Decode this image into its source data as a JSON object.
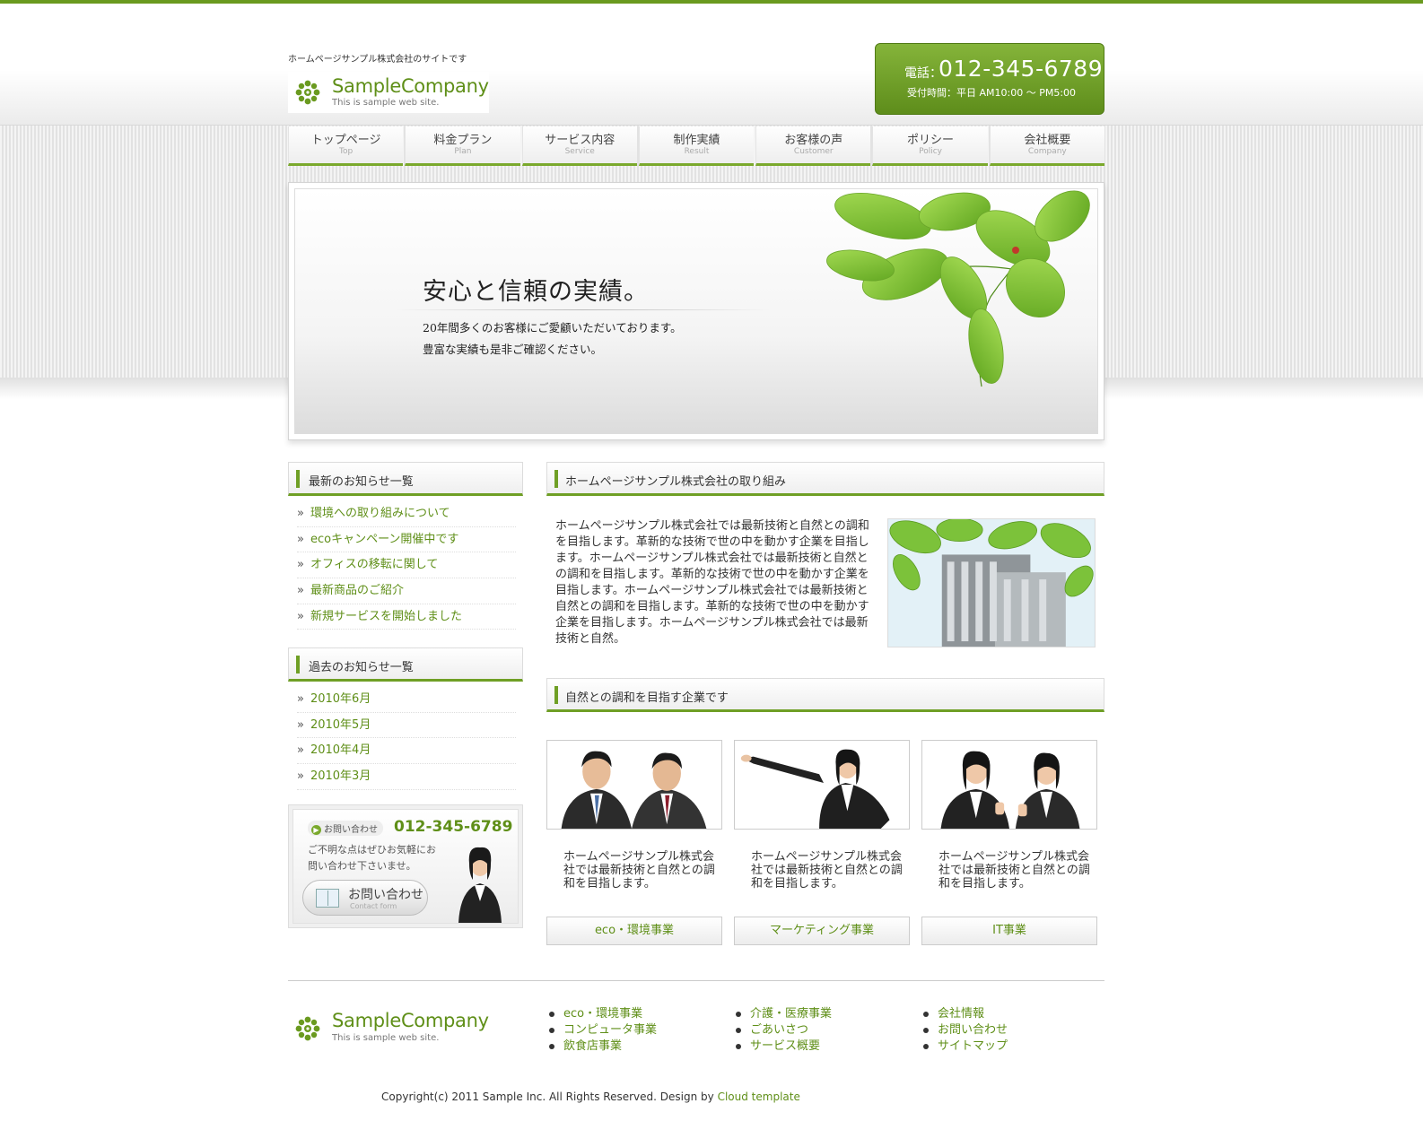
{
  "header": {
    "tagline": "ホームページサンプル株式会社のサイトです",
    "logo_name": "SampleCompany",
    "logo_sub": "This is sample web site.",
    "tel_label": "電話：",
    "tel_number": "012-345-6789",
    "tel_hours": "受付時間：平日 AM10:00 〜 PM5:00"
  },
  "nav": [
    {
      "jp": "トップページ",
      "en": "Top"
    },
    {
      "jp": "料金プラン",
      "en": "Plan"
    },
    {
      "jp": "サービス内容",
      "en": "Service"
    },
    {
      "jp": "制作実績",
      "en": "Result"
    },
    {
      "jp": "お客様の声",
      "en": "Customer"
    },
    {
      "jp": "ポリシー",
      "en": "Policy"
    },
    {
      "jp": "会社概要",
      "en": "Company"
    }
  ],
  "hero": {
    "title": "安心と信頼の実績。",
    "line1": "20年間多くのお客様にご愛顧いただいております。",
    "line2": "豊富な実績も是非ご確認ください。"
  },
  "sidebar": {
    "news_title": "最新のお知らせ一覧",
    "news": [
      "環境への取り組みについて",
      "ecoキャンペーン開催中です",
      "オフィスの移転に関して",
      "最新商品のご紹介",
      "新規サービスを開始しました"
    ],
    "archive_title": "過去のお知らせ一覧",
    "archive": [
      "2010年6月",
      "2010年5月",
      "2010年4月",
      "2010年3月"
    ],
    "contact": {
      "label": "お問い合わせ",
      "tel": "012-345-6789",
      "text": "ご不明な点はぜひお気軽にお問い合わせ下さいませ。",
      "button": "お問い合わせ",
      "button_sub": "Contact form"
    }
  },
  "main": {
    "section1_title": "ホームページサンプル株式会社の取り組み",
    "intro": "ホームページサンプル株式会社では最新技術と自然との調和を目指します。革新的な技術で世の中を動かす企業を目指します。ホームページサンプル株式会社では最新技術と自然との調和を目指します。革新的な技術で世の中を動かす企業を目指します。ホームページサンプル株式会社では最新技術と自然との調和を目指します。革新的な技術で世の中を動かす企業を目指します。ホームページサンプル株式会社では最新技術と自然。",
    "section2_title": "自然との調和を目指す企業です",
    "cards": [
      {
        "text": "ホームページサンプル株式会社では最新技術と自然との調和を目指します。",
        "button": "eco・環境事業"
      },
      {
        "text": "ホームページサンプル株式会社では最新技術と自然との調和を目指します。",
        "button": "マーケティング事業"
      },
      {
        "text": "ホームページサンプル株式会社では最新技術と自然との調和を目指します。",
        "button": "IT事業"
      }
    ]
  },
  "footer": {
    "logo_name": "SampleCompany",
    "logo_sub": "This is sample web site.",
    "col1": [
      "eco・環境事業",
      "コンピュータ事業",
      "飲食店事業"
    ],
    "col2": [
      "介護・医療事業",
      "ごあいさつ",
      "サービス概要"
    ],
    "col3": [
      "会社情報",
      "お問い合わせ",
      "サイトマップ"
    ],
    "copyright": "Copyright(c) 2011 Sample Inc. All Rights Reserved. Design by",
    "design_link": "Cloud template"
  },
  "colors": {
    "accent": "#6a9a1f",
    "link": "#5f8f18"
  }
}
